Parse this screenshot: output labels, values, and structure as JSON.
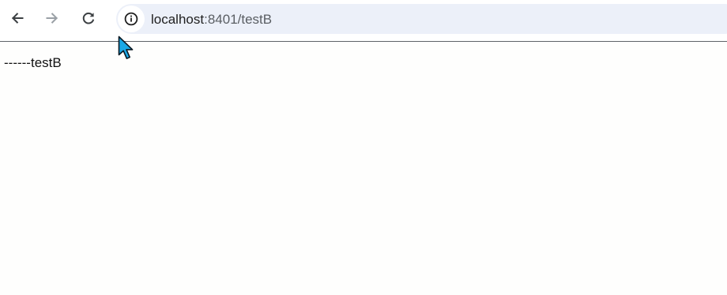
{
  "browser": {
    "back_icon": "arrow-left-icon",
    "forward_icon": "arrow-right-icon",
    "reload_icon": "reload-icon",
    "site_info_icon": "info-icon",
    "url_host": "localhost",
    "url_rest": ":8401/testB",
    "colors": {
      "omnibox_bg": "#ecf0f9",
      "page_bg": "#fefefd",
      "cursor_fill": "#1aa8e6"
    }
  },
  "page": {
    "body_text": "------testB"
  },
  "cursor": {
    "icon": "mouse-pointer-icon"
  }
}
